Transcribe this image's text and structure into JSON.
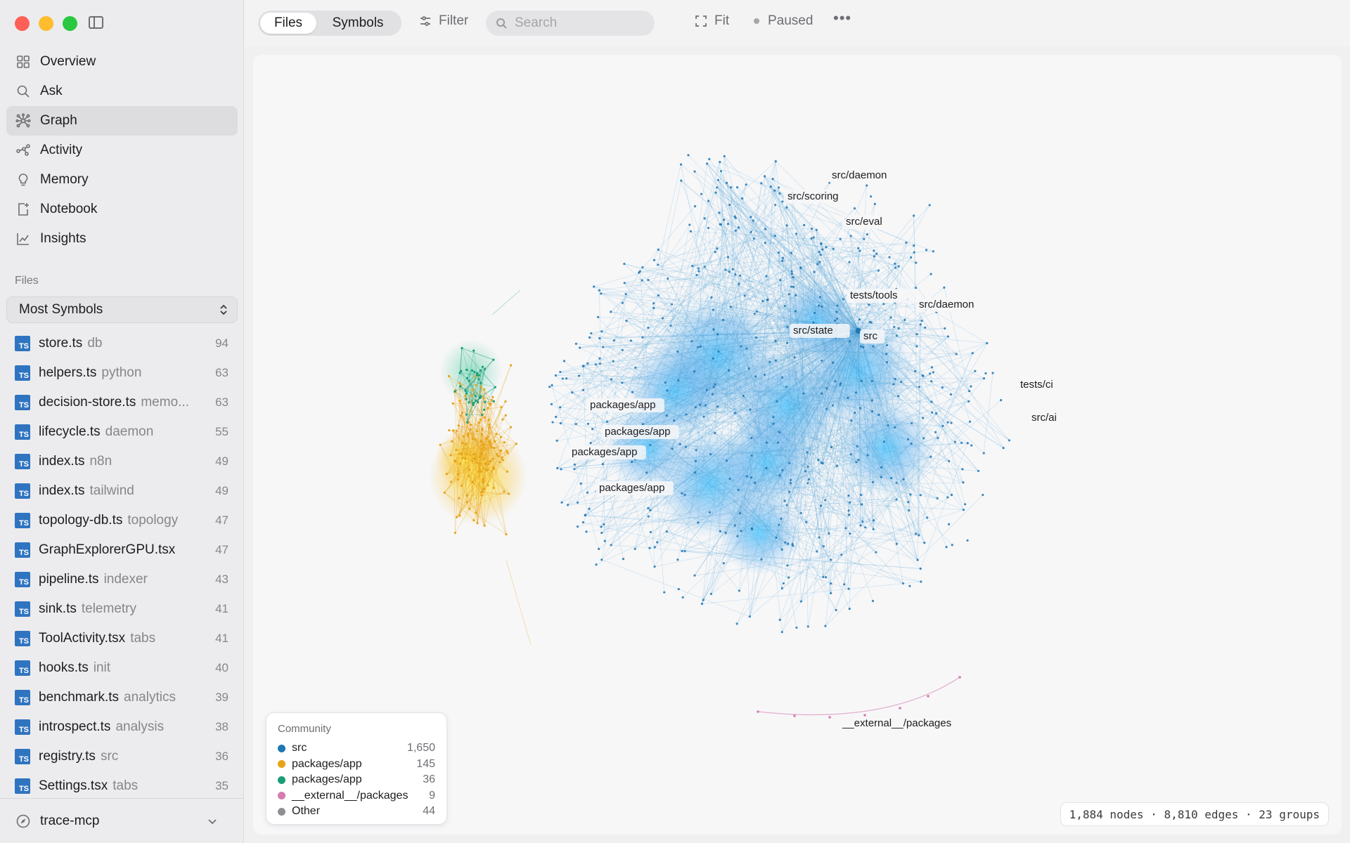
{
  "sidebar": {
    "nav": [
      {
        "label": "Overview",
        "icon": "grid-icon"
      },
      {
        "label": "Ask",
        "icon": "search-icon"
      },
      {
        "label": "Graph",
        "icon": "graph-icon",
        "active": true
      },
      {
        "label": "Activity",
        "icon": "activity-icon"
      },
      {
        "label": "Memory",
        "icon": "lightbulb-icon"
      },
      {
        "label": "Notebook",
        "icon": "notebook-icon"
      },
      {
        "label": "Insights",
        "icon": "chart-icon"
      }
    ],
    "files_label": "Files",
    "sort": "Most Symbols",
    "files": [
      {
        "name": "store.ts",
        "dir": "db",
        "count": "94"
      },
      {
        "name": "helpers.ts",
        "dir": "python",
        "count": "63"
      },
      {
        "name": "decision-store.ts",
        "dir": "memo...",
        "count": "63"
      },
      {
        "name": "lifecycle.ts",
        "dir": "daemon",
        "count": "55"
      },
      {
        "name": "index.ts",
        "dir": "n8n",
        "count": "49"
      },
      {
        "name": "index.ts",
        "dir": "tailwind",
        "count": "49"
      },
      {
        "name": "topology-db.ts",
        "dir": "topology",
        "count": "47"
      },
      {
        "name": "GraphExplorerGPU.tsx",
        "dir": "",
        "count": "47"
      },
      {
        "name": "pipeline.ts",
        "dir": "indexer",
        "count": "43"
      },
      {
        "name": "sink.ts",
        "dir": "telemetry",
        "count": "41"
      },
      {
        "name": "ToolActivity.tsx",
        "dir": "tabs",
        "count": "41"
      },
      {
        "name": "hooks.ts",
        "dir": "init",
        "count": "40"
      },
      {
        "name": "benchmark.ts",
        "dir": "analytics",
        "count": "39"
      },
      {
        "name": "introspect.ts",
        "dir": "analysis",
        "count": "38"
      },
      {
        "name": "registry.ts",
        "dir": "src",
        "count": "36"
      },
      {
        "name": "Settings.tsx",
        "dir": "tabs",
        "count": "35"
      }
    ],
    "badge": "TS",
    "project": "trace-mcp"
  },
  "toolbar": {
    "tab_files": "Files",
    "tab_symbols": "Symbols",
    "filter": "Filter",
    "search_placeholder": "Search",
    "fit": "Fit",
    "status": "Paused",
    "more": "•••"
  },
  "graph": {
    "labels": [
      {
        "text": "src/daemon",
        "group": "src"
      },
      {
        "text": "src/scoring",
        "group": "src"
      },
      {
        "text": "src/eval",
        "group": "src"
      },
      {
        "text": "tests/tools",
        "group": "src"
      },
      {
        "text": "src/daemon",
        "group": "src"
      },
      {
        "text": "src/state",
        "group": "src"
      },
      {
        "text": "src",
        "group": "src"
      },
      {
        "text": "tests/ci",
        "group": "src"
      },
      {
        "text": "src/ai",
        "group": "src"
      },
      {
        "text": "packages/app",
        "group": "packages/app"
      },
      {
        "text": "packages/app",
        "group": "packages/app"
      },
      {
        "text": "packages/app",
        "group": "packages/app"
      },
      {
        "text": "packages/app",
        "group": "packages/app"
      },
      {
        "text": "__external__/packages",
        "group": "__external__/packages"
      }
    ]
  },
  "legend": {
    "title": "Community",
    "items": [
      {
        "name": "src",
        "count": "1,650",
        "color": "#1f77b4"
      },
      {
        "name": "packages/app",
        "count": "145",
        "color": "#e8a317"
      },
      {
        "name": "packages/app",
        "count": "36",
        "color": "#1a9e77"
      },
      {
        "name": "__external__/packages",
        "count": "9",
        "color": "#d67bb0"
      },
      {
        "name": "Other",
        "count": "44",
        "color": "#8e8e93"
      }
    ]
  },
  "stats": "1,884 nodes · 8,810 edges · 23 groups"
}
